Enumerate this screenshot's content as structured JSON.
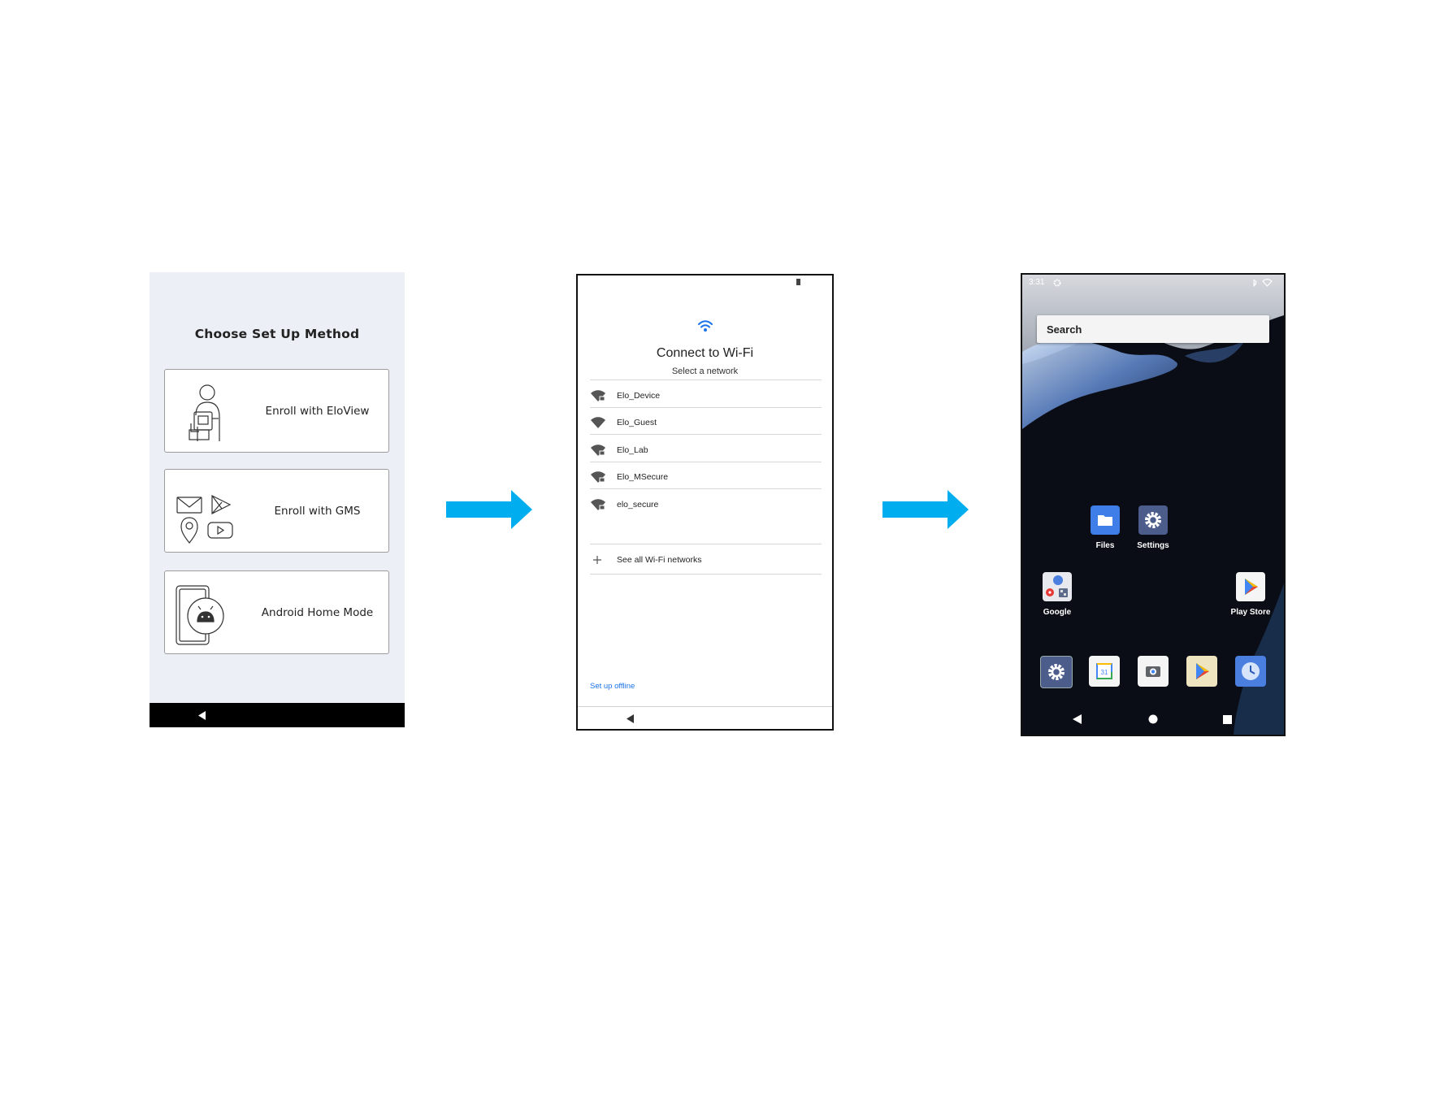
{
  "screen1": {
    "title": "Choose Set Up Method",
    "options": [
      {
        "label": "Enroll with EloView"
      },
      {
        "label": "Enroll with GMS"
      },
      {
        "label": "Android Home Mode"
      }
    ]
  },
  "screen2": {
    "title": "Connect to Wi-Fi",
    "subtitle": "Select a network",
    "networks": [
      "Elo_Device",
      "Elo_Guest",
      "Elo_Lab",
      "Elo_MSecure",
      "elo_secure"
    ],
    "see_all": "See all Wi-Fi networks",
    "offline_link": "Set up offline",
    "accent_color": "#1a73e8"
  },
  "screen3": {
    "status_time": "3:31",
    "search_label": "Search",
    "apps": {
      "files": "Files",
      "settings": "Settings",
      "google": "Google",
      "play_store": "Play Store"
    }
  },
  "arrow_color": "#00aeef"
}
